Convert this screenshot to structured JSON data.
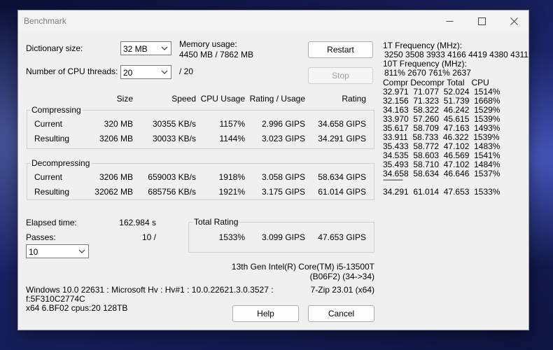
{
  "window": {
    "title": "Benchmark"
  },
  "settings": {
    "dictionary_label": "Dictionary size:",
    "dictionary_value": "32 MB",
    "threads_label": "Number of CPU threads:",
    "threads_value": "20",
    "threads_total": "/ 20",
    "memory_label": "Memory usage:",
    "memory_value": "4450 MB / 7862 MB"
  },
  "buttons": {
    "restart": "Restart",
    "stop": "Stop",
    "help": "Help",
    "cancel": "Cancel"
  },
  "columns": {
    "size": "Size",
    "speed": "Speed",
    "cpu_usage": "CPU Usage",
    "rating_usage": "Rating / Usage",
    "rating": "Rating"
  },
  "compressing": {
    "label": "Compressing",
    "rows": [
      {
        "name": "Current",
        "size": "320 MB",
        "speed": "30355 KB/s",
        "cpu": "1157%",
        "rating_usage": "2.996 GIPS",
        "rating": "34.658 GIPS"
      },
      {
        "name": "Resulting",
        "size": "3206 MB",
        "speed": "30033 KB/s",
        "cpu": "1144%",
        "rating_usage": "3.023 GIPS",
        "rating": "34.291 GIPS"
      }
    ]
  },
  "decompressing": {
    "label": "Decompressing",
    "rows": [
      {
        "name": "Current",
        "size": "3206 MB",
        "speed": "659003 KB/s",
        "cpu": "1918%",
        "rating_usage": "3.058 GIPS",
        "rating": "58.634 GIPS"
      },
      {
        "name": "Resulting",
        "size": "32062 MB",
        "speed": "685756 KB/s",
        "cpu": "1921%",
        "rating_usage": "3.175 GIPS",
        "rating": "61.014 GIPS"
      }
    ]
  },
  "elapsed": {
    "label": "Elapsed time:",
    "value": "162.984 s"
  },
  "passes": {
    "label": "Passes:",
    "value": "10 /",
    "select_value": "10"
  },
  "total_rating": {
    "label": "Total Rating",
    "cpu": "1533%",
    "rating_usage": "3.099 GIPS",
    "rating": "47.653 GIPS"
  },
  "cpu_info": {
    "line1": "13th Gen Intel(R) Core(TM) i5-13500T",
    "line2": "(B06F2) (34->34)"
  },
  "sys_info": {
    "line1": "Windows 10.0 22631 : Microsoft Hv : Hv#1 : 10.0.22621.3.0.3527 :",
    "line2": "f:5F310C2774C",
    "line3": "x64 6.BF02 cpus:20 128TB",
    "version": "7-Zip 23.01 (x64)"
  },
  "log": {
    "freq1_label": "1T Frequency (MHz):",
    "freq1_values": "3250 3508 3933 4166 4419 4380 4311",
    "freq10_label": "10T Frequency (MHz):",
    "freq10_values": "811% 2670 761% 2637",
    "header": "Compr Decompr Total   CPU",
    "rows": [
      "32.971  71.077  52.024  1514%",
      "32.156  71.323  51.739  1668%",
      "34.163  58.322  46.242  1529%",
      "33.970  57.260  45.615  1539%",
      "35.617  58.709  47.163  1493%",
      "33.911  58.733  46.322  1539%",
      "35.433  58.772  47.102  1483%",
      "34.535  58.603  46.569  1541%",
      "35.493  58.710  47.102  1484%",
      "34.658  58.634  46.646  1537%"
    ],
    "separator": "------------",
    "summary": "34.291  61.014  47.653  1533%"
  }
}
